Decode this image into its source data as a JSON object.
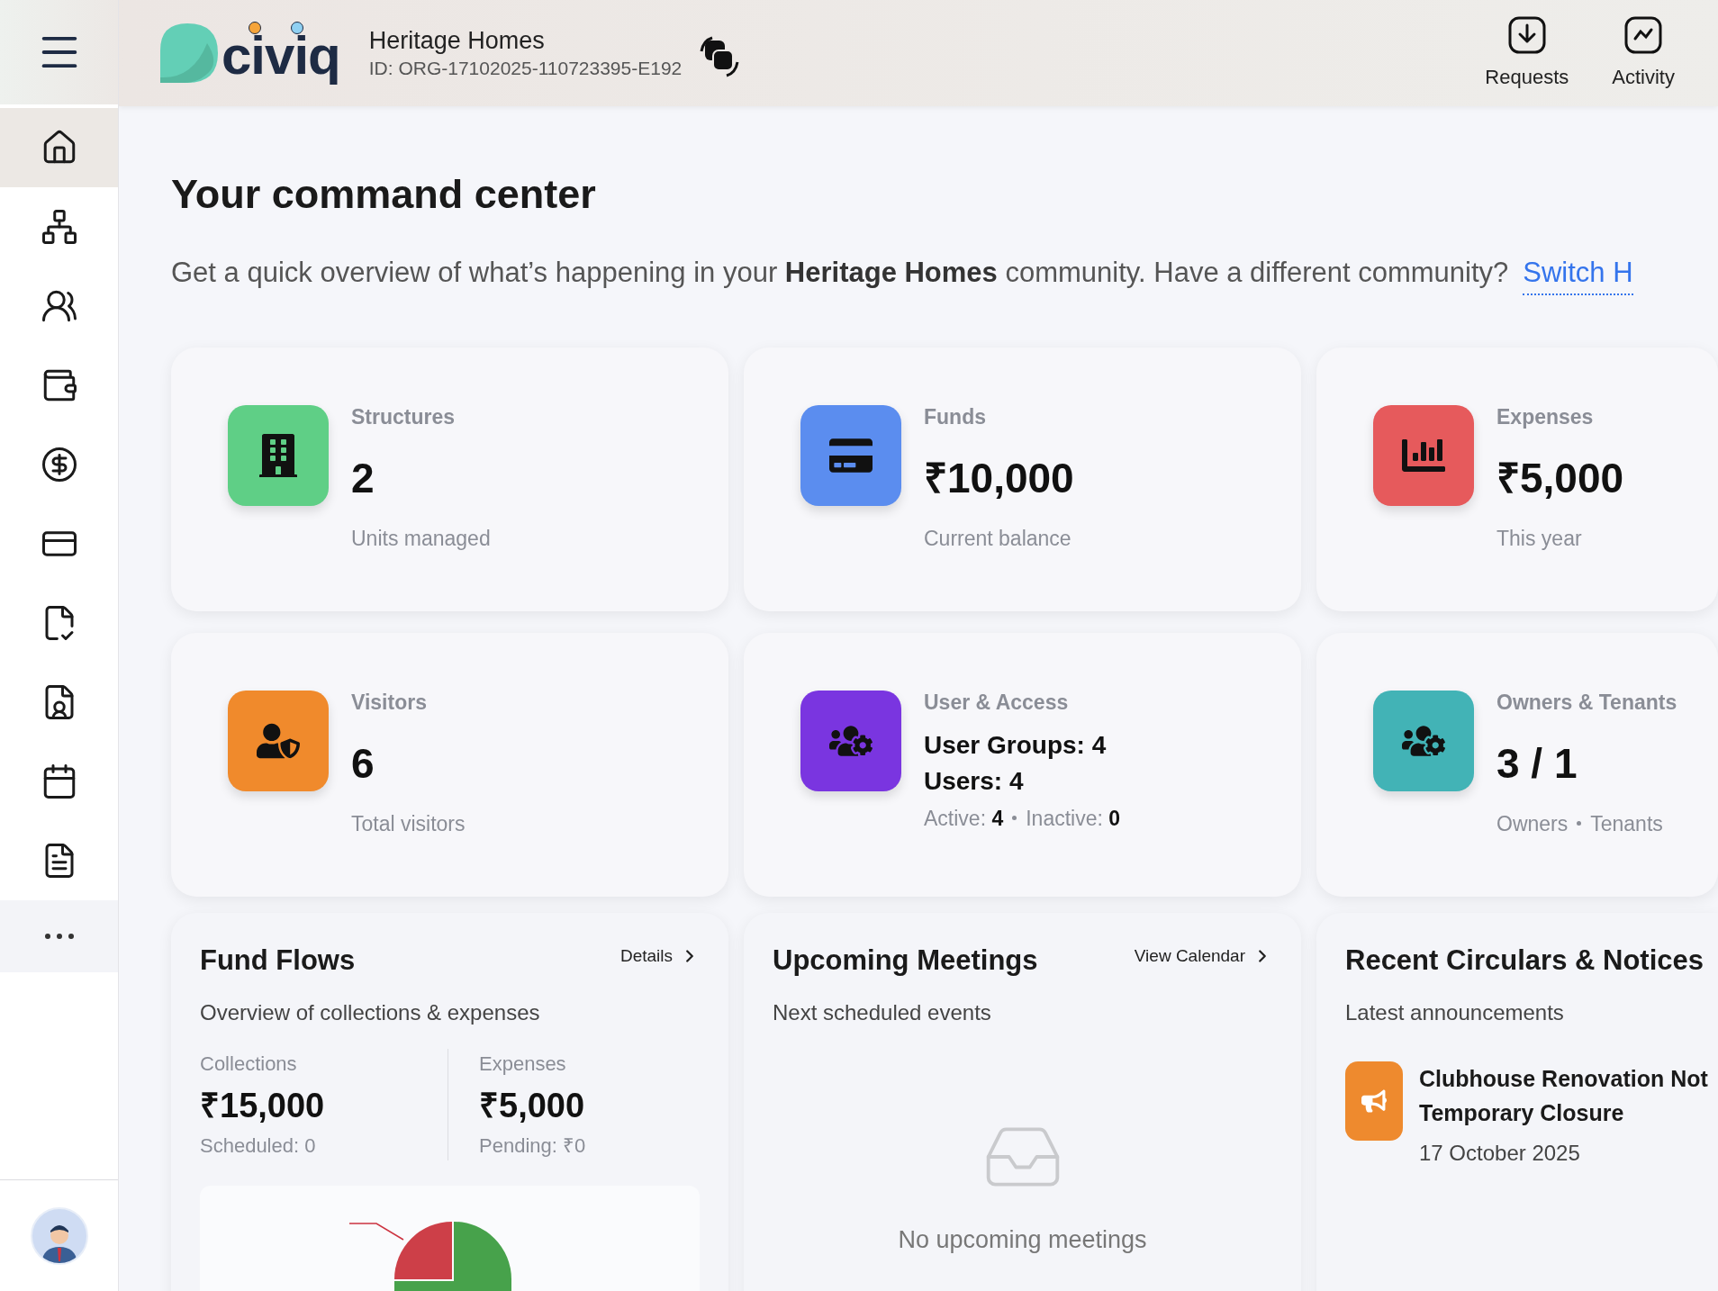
{
  "header": {
    "logo_text": "civiq",
    "org_name": "Heritage Homes",
    "org_id": "ID: ORG-17102025-110723395-E192",
    "actions": [
      {
        "label": "Requests"
      },
      {
        "label": "Activity"
      }
    ]
  },
  "sidebar": {
    "items": [
      {
        "selected": true
      },
      {
        "selected": false
      },
      {
        "selected": false
      },
      {
        "selected": false
      },
      {
        "selected": false
      },
      {
        "selected": false
      },
      {
        "selected": false
      },
      {
        "selected": false
      },
      {
        "selected": false
      },
      {
        "selected": false
      }
    ]
  },
  "page": {
    "title": "Your command center",
    "subtitle": "Get a quick overview of what’s happening in your **Heritage Homes** community. Have a different community?",
    "switch_link": "Switch H"
  },
  "stats": [
    {
      "kind": "simple",
      "label": "Structures",
      "value": "2",
      "note": "Units managed",
      "color": "#5fcf86"
    },
    {
      "kind": "simple",
      "label": "Funds",
      "value": "₹10,000",
      "note": "Current balance",
      "color": "#5b8def"
    },
    {
      "kind": "simple",
      "label": "Expenses",
      "value": "₹5,000",
      "note": "This year",
      "color": "#e65a5c"
    },
    {
      "kind": "simple",
      "label": "Visitors",
      "value": "6",
      "note": "Total visitors",
      "color": "#f08a2c"
    },
    {
      "kind": "access",
      "label": "User & Access",
      "lines": [
        "User Groups: 4",
        "Users: 4"
      ],
      "note_parts": [
        "Active: **4**",
        "Inactive: **0**"
      ],
      "color": "#7a35e0"
    },
    {
      "kind": "split",
      "label": "Owners & Tenants",
      "value": "3 / 1",
      "note_parts": [
        "Owners",
        "Tenants"
      ],
      "color": "#42b3b6"
    }
  ],
  "fund_flows": {
    "title": "Fund Flows",
    "link": "Details",
    "subtitle": "Overview of collections & expenses",
    "columns": [
      {
        "label": "Collections",
        "value": "₹15,000",
        "note": "Scheduled: 0"
      },
      {
        "label": "Expenses",
        "value": "₹5,000",
        "note": "Pending: ₹0"
      }
    ]
  },
  "meetings": {
    "title": "Upcoming Meetings",
    "link": "View Calendar",
    "subtitle": "Next scheduled events",
    "empty": "No upcoming meetings"
  },
  "circulars": {
    "title": "Recent Circulars & Notices",
    "subtitle": "Latest announcements",
    "items": [
      {
        "title_lines": [
          "Clubhouse Renovation Not",
          "Temporary Closure"
        ],
        "date": "17 October 2025"
      }
    ]
  }
}
